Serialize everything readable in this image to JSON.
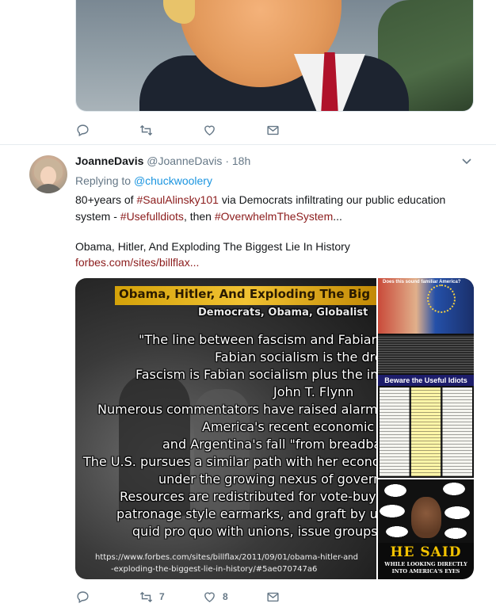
{
  "previous_tweet": {
    "actions": {
      "reply_count": "",
      "retweet_count": "",
      "like_count": ""
    }
  },
  "tweet": {
    "display_name": "JoanneDavis",
    "handle": "@JoanneDavis",
    "separator": "·",
    "time": "18h",
    "replying_prefix": "Replying to ",
    "replying_to": "@chuckwoolery",
    "text": {
      "part1": "80+years of ",
      "tag1": "#SaulAlinsky101",
      "part2": " via Democrats infiltrating our public education system - ",
      "tag2": "#Usefulldiots",
      "part3": ", then ",
      "tag3": "#OverwhelmTheSystem",
      "part4": "..."
    },
    "link_card": {
      "title": "Obama, Hitler, And Exploding The Biggest Lie In History",
      "url": "forbes.com/sites/billflax..."
    },
    "media": {
      "main_image_lines": [
        "Obama, Hitler, And Exploding The Big",
        "Democrats, Obama, Globalist",
        "\"The line between fascism and Fabian so",
        "Fabian socialism is the dre",
        "Fascism is Fabian socialism plus the in",
        "John T. Flynn",
        "Numerous commentators have raised alarmi",
        "America's recent economic",
        "and Argentina's fall \"from breadbasket",
        "The U.S. pursues a similar path with her econo",
        "under the growing nexus of govern",
        "Resources are redistributed for vote-buyi",
        "patronage style earmarks, and graft by un",
        "quid pro quo with unions, issue groups an"
      ],
      "main_image_url_lines": [
        "https://www.forbes.com/sites/billflax/2011/09/01/obama-hitler-and",
        "-exploding-the-biggest-lie-in-history/#5ae070747a6"
      ],
      "side_top_heading": "Does this sound familiar America?",
      "side_top_banner": "Beware the Useful Idiots",
      "side_bottom_title": "HE SAID",
      "side_bottom_caption": "WHILE LOOKING DIRECTLY INTO AMERICA'S EYES"
    },
    "actions": {
      "reply_count": "",
      "retweet_count": "7",
      "like_count": "8"
    }
  },
  "colors": {
    "link": "#1b95e0",
    "hashtag": "#8b1b1b",
    "muted": "#657786",
    "text": "#14171a"
  }
}
